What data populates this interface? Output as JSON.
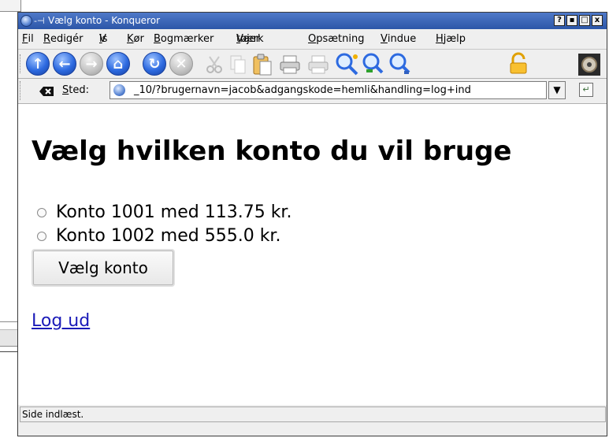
{
  "window": {
    "title": "Vælg konto - Konqueror",
    "sticky_glyph": "-⊣",
    "buttons": {
      "help": "?",
      "minimize": "▪",
      "maximize": "□",
      "close": "x"
    }
  },
  "menu": [
    {
      "pre": "",
      "key": "F",
      "rest": "il"
    },
    {
      "pre": "",
      "key": "R",
      "rest": "edigér"
    },
    {
      "pre": "V",
      "key": "i",
      "rest": "s"
    },
    {
      "pre": "",
      "key": "K",
      "rest": "ør"
    },
    {
      "pre": "",
      "key": "B",
      "rest": "ogmærker"
    },
    {
      "pre": "Værk",
      "key": "t",
      "rest": "øjer"
    },
    {
      "pre": "",
      "key": "O",
      "rest": "psætning"
    },
    {
      "pre": "",
      "key": "V",
      "rest": "indue"
    },
    {
      "pre": "",
      "key": "H",
      "rest": "jælp"
    }
  ],
  "toolbar": {
    "icons": [
      "up-icon",
      "back-icon",
      "forward-icon",
      "home-icon",
      "reload-icon",
      "stop-icon",
      "cut-icon",
      "copy-icon",
      "paste-icon",
      "print-icon",
      "print-frame-icon",
      "zoom-in-icon",
      "zoom-out-icon",
      "find-icon",
      "security-icon",
      "konqueror-gear-icon"
    ]
  },
  "location": {
    "label_key": "S",
    "label_rest": "ted:",
    "url": "_10/?brugernavn=jacob&adgangskode=hemli&handling=log+ind"
  },
  "page": {
    "heading": "Vælg hvilken konto du vil bruge",
    "options": [
      {
        "label": "Konto 1001 med 113.75 kr."
      },
      {
        "label": "Konto 1002 med 555.0 kr."
      }
    ],
    "submit_label": "Vælg konto",
    "logout_label": "Log ud"
  },
  "status": {
    "text": "Side indlæst."
  }
}
